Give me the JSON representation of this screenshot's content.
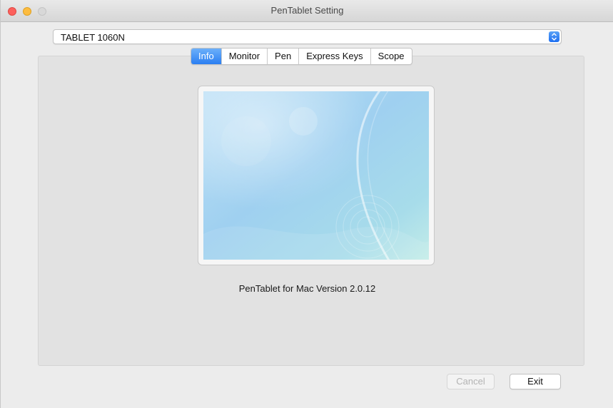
{
  "window": {
    "title": "PenTablet Setting"
  },
  "device_select": {
    "value": "TABLET 1060N"
  },
  "tabs": [
    {
      "label": "Info",
      "active": true
    },
    {
      "label": "Monitor",
      "active": false
    },
    {
      "label": "Pen",
      "active": false
    },
    {
      "label": "Express Keys",
      "active": false
    },
    {
      "label": "Scope",
      "active": false
    }
  ],
  "info": {
    "version_text": "PenTablet for Mac Version 2.0.12"
  },
  "buttons": {
    "cancel_label": "Cancel",
    "exit_label": "Exit"
  },
  "colors": {
    "accent": "#2a7ef2",
    "close": "#fc605c",
    "minimize": "#fdbc40"
  }
}
